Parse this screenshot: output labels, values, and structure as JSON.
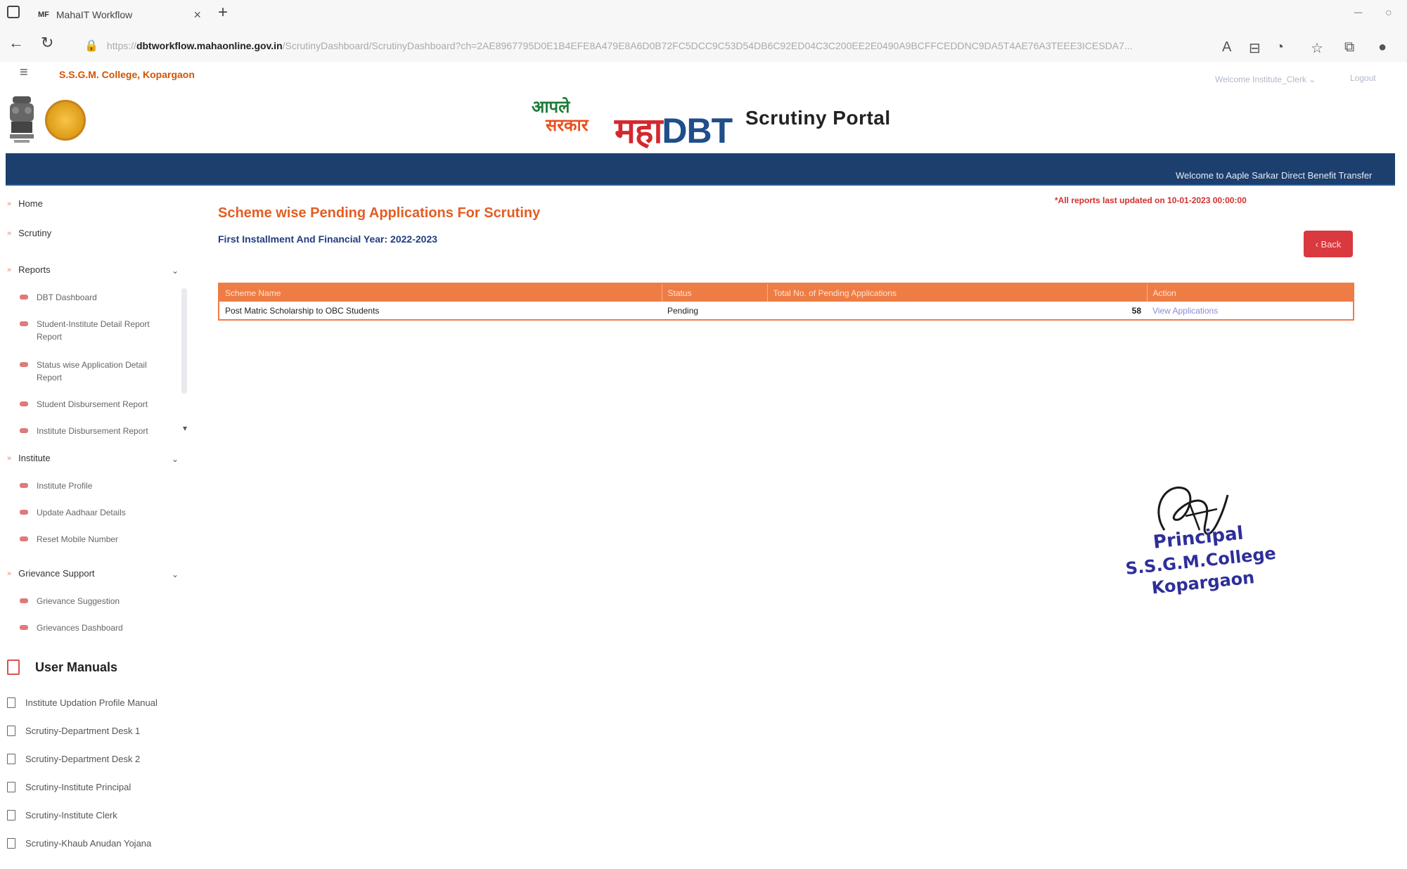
{
  "browser": {
    "tab_favicon": "MF",
    "tab_title": "MahaIT Workflow",
    "close_glyph": "×",
    "new_tab_glyph": "+",
    "url_scheme": "https://",
    "url_host": "dbtworkflow.mahaonline.gov.in",
    "url_path": "/ScrutinyDashboard/ScrutinyDashboard?ch=2AE8967795D0E1B4EFE8A479E8A6D0B72FC5DCC9C53D54DB6C92ED04C3C200EE2E0490A9BCFFCEDDNC9DA5T4AE76A3TEEE3ICESDA7...",
    "icons": [
      "back-icon",
      "reload-icon",
      "lock-icon",
      "read-aloud-icon",
      "favorites-icon",
      "collections-icon",
      "extensions-icon",
      "profile-icon"
    ]
  },
  "portal": {
    "college_name": "S.S.G.M. College, Kopargaon",
    "welcome_user": "Welcome Institute_Clerk",
    "logout_label": "Logout",
    "logo_aple_line1": "आपले",
    "logo_aple_line2": "सरकार",
    "logo_maha": "महा",
    "logo_dbt": "DBT",
    "portal_title": "Scrutiny Portal",
    "marquee": "Welcome to Aaple Sarkar Direct Benefit Transfer"
  },
  "sidebar": {
    "home": "Home",
    "scrutiny": "Scrutiny",
    "reports": "Reports",
    "report_items": [
      "DBT Dashboard",
      "Student-Institute Detail Report Report",
      "Status wise Application Detail Report",
      "Student Disbursement Report",
      "Institute Disbursement Report"
    ],
    "institute": "Institute",
    "institute_items": [
      "Institute Profile",
      "Update Aadhaar Details",
      "Reset Mobile Number"
    ],
    "grievance": "Grievance Support",
    "grievance_items": [
      "Grievance Suggestion",
      "Grievances Dashboard"
    ],
    "user_manuals_title": "User Manuals",
    "manuals": [
      "Institute Updation Profile Manual",
      "Scrutiny-Department Desk 1",
      "Scrutiny-Department Desk 2",
      "Scrutiny-Institute Principal",
      "Scrutiny-Institute Clerk",
      "Scrutiny-Khaub Anudan Yojana"
    ]
  },
  "main": {
    "title": "Scheme wise Pending Applications For Scrutiny",
    "subtitle": "First Installment And Financial Year: 2022-2023",
    "updated_note": "*All reports last updated on 10-01-2023 00:00:00",
    "back_label": "‹ Back",
    "table": {
      "headers": [
        "Scheme Name",
        "Status",
        "Total No. of Pending Applications",
        "Action"
      ],
      "rows": [
        {
          "scheme": "Post Matric Scholarship to OBC Students",
          "status": "Pending",
          "count": "58",
          "action": "View Applications"
        }
      ]
    }
  },
  "stamp": {
    "line1": "Principal",
    "line2": "S.S.G.M.College",
    "line3": "Kopargaon"
  },
  "colors": {
    "accent_orange": "#e35d24",
    "header_blue": "#1c3f6e",
    "table_orange": "#ee7d45",
    "back_red": "#d9393f"
  }
}
